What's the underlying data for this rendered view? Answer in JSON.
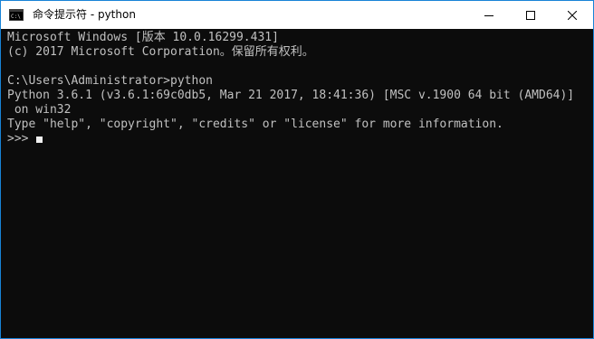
{
  "window": {
    "title": "命令提示符 - python",
    "icon": "cmd-icon",
    "controls": {
      "minimize_icon": "minimize-icon",
      "maximize_icon": "maximize-icon",
      "close_icon": "close-icon"
    }
  },
  "console": {
    "lines": [
      "Microsoft Windows [版本 10.0.16299.431]",
      "(c) 2017 Microsoft Corporation。保留所有权利。",
      "C:\\Users\\Administrator>python",
      "Python 3.6.1 (v3.6.1:69c0db5, Mar 21 2017, 18:41:36) [MSC v.1900 64 bit (AMD64)]",
      " on win32",
      "Type \"help\", \"copyright\", \"credits\" or \"license\" for more information.",
      ">>>"
    ],
    "colors": {
      "background": "#0c0c0c",
      "text": "#c0c0c0",
      "cursor": "#f0f0f0"
    }
  }
}
